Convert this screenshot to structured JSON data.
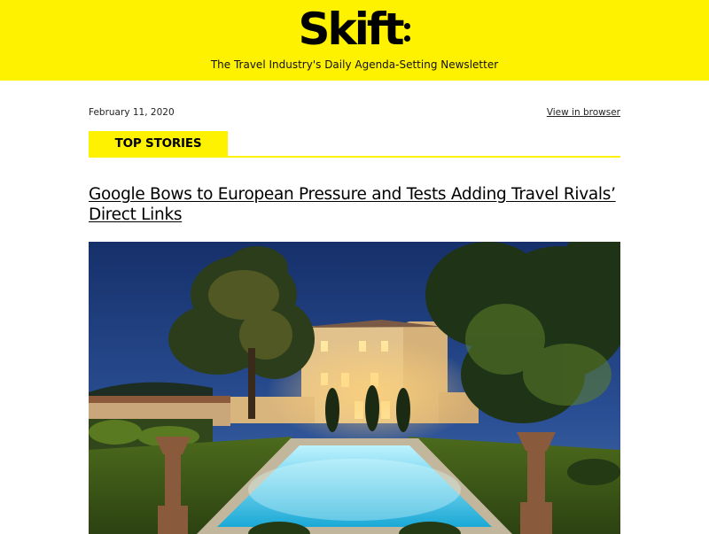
{
  "brand": {
    "logo_text": "Skift",
    "tagline": "The Travel Industry's Daily Agenda-Setting Newsletter",
    "accent_color": "#fff200"
  },
  "meta": {
    "date": "February 11, 2020",
    "view_in_browser": "View in browser"
  },
  "section": {
    "label": "TOP STORIES"
  },
  "story": {
    "headline": "Google Bows to European Pressure and Tests Adding Travel Rivals’ Direct Links"
  }
}
